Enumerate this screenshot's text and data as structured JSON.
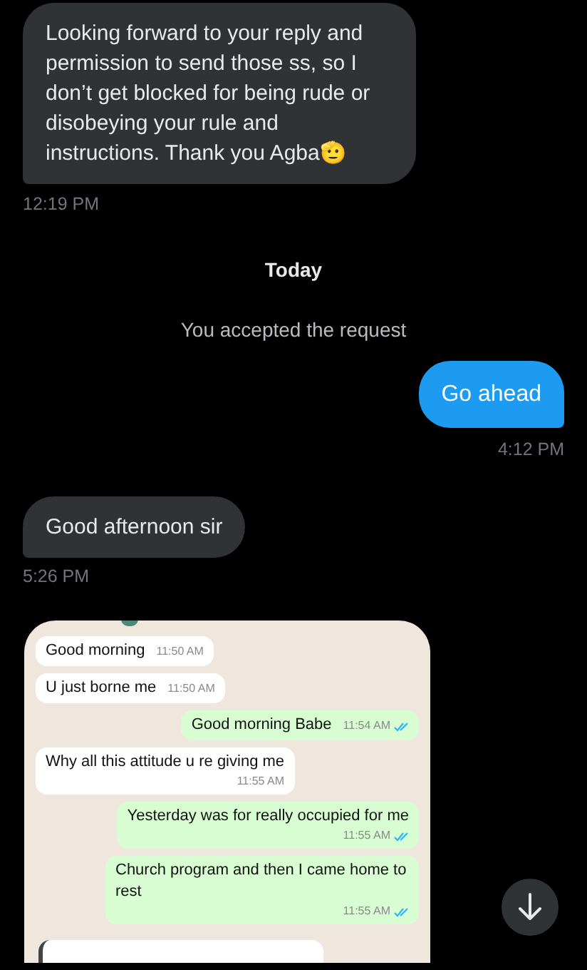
{
  "messages": [
    {
      "kind": "received",
      "text": "Looking forward to your reply and permission to send those ss, so I don’t get blocked for being rude or disobeying your rule and instructions.  Thank you Agba🫡",
      "time": "12:19 PM"
    },
    {
      "kind": "day",
      "text": "Today"
    },
    {
      "kind": "notice",
      "text": "You accepted the request"
    },
    {
      "kind": "sent",
      "text": "Go ahead",
      "time": "4:12 PM"
    },
    {
      "kind": "received",
      "text": "Good afternoon sir",
      "time": "5:26 PM"
    },
    {
      "kind": "screenshot",
      "chat": [
        {
          "kind": "incoming",
          "text": "Good morning",
          "time": "11:50 AM",
          "inline": true
        },
        {
          "kind": "incoming",
          "text": "U just borne me",
          "time": "11:50 AM",
          "inline": true
        },
        {
          "kind": "outgoing",
          "text": "Good morning Babe",
          "time": "11:54 AM",
          "inline": true,
          "read": true
        },
        {
          "kind": "incoming",
          "text": "Why all this attitude u re giving me",
          "time": "11:55 AM",
          "inline": false
        },
        {
          "kind": "outgoing",
          "text": "Yesterday was for really occupied for me",
          "time": "11:55 AM",
          "inline": false,
          "read": true
        },
        {
          "kind": "outgoing",
          "text": "Church program and then I came home to rest",
          "time": "11:55 AM",
          "inline": false,
          "read": true
        }
      ]
    }
  ]
}
